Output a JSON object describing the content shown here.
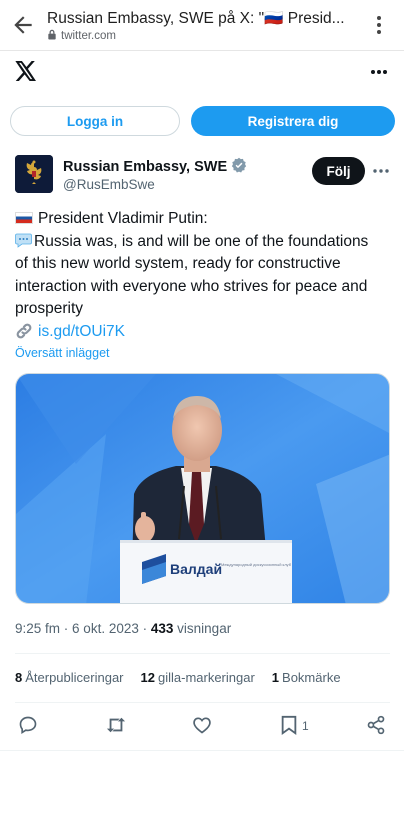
{
  "browser": {
    "title": "Russian Embassy, SWE på X: \"🇷🇺 Presid...",
    "url": "twitter.com",
    "icons": {
      "back": "arrow-left-icon",
      "lock": "lock-icon",
      "menu": "kebab-menu-icon"
    }
  },
  "x_header": {
    "logo": "x-logo",
    "more": "more-horizontal-icon"
  },
  "auth": {
    "login_label": "Logga in",
    "register_label": "Registrera dig"
  },
  "tweet": {
    "author_name": "Russian Embassy, SWE",
    "handle": "@RusEmbSwe",
    "verified": true,
    "follow_label": "Följ",
    "text_lines": [
      "President Vladimir Putin:",
      "Russia was, is and will be one of the foundations",
      "of this new world system, ready for constructive",
      "interaction with everyone who strives for peace and",
      "prosperity"
    ],
    "link": "is.gd/tOUi7K",
    "translate_label": "Översätt inlägget",
    "image": {
      "podium_logo_text": "Валдай",
      "podium_logo_subtitle": "Международный дискуссионный клуб"
    },
    "time": "9:25 fm",
    "date": "6 okt. 2023",
    "views_count": "433",
    "views_label": "visningar",
    "reposts_count": "8",
    "reposts_label": "Återpubliceringar",
    "likes_count": "12",
    "likes_label": "gilla-markeringar",
    "bookmarks_count": "1",
    "bookmarks_label": "Bokmärke",
    "bookmark_action_count": "1"
  },
  "colors": {
    "accent": "#1d9bf0",
    "text": "#0f1419",
    "muted": "#536471",
    "follow_bg": "#0f1419"
  }
}
